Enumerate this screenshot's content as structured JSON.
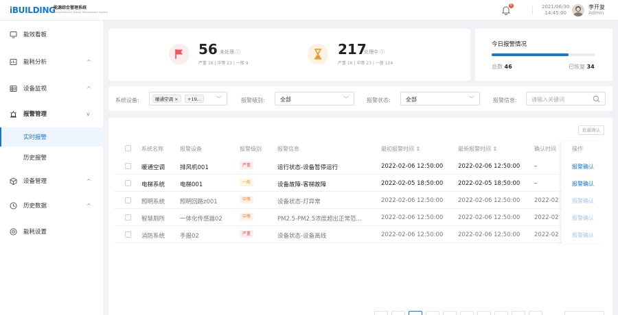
{
  "app": {
    "logo": "iBUILDING",
    "system_name": "能源综合管理系统",
    "system_name_en": "Comprehensive Energy Management System"
  },
  "header": {
    "notification_count": "6",
    "date": "2021/06/30",
    "time": "14:45:00",
    "user_name": "李开复",
    "user_role": "Admin"
  },
  "sidebar": {
    "items": [
      {
        "label": "能效看板",
        "icon": "monitor-icon"
      },
      {
        "label": "能耗分析",
        "icon": "chart-icon",
        "chevron": "^"
      },
      {
        "label": "设备监视",
        "icon": "grid-icon",
        "chevron": "^"
      },
      {
        "label": "报警管理",
        "icon": "alarm-icon",
        "chevron": "v"
      },
      {
        "label": "实时报警",
        "active": true
      },
      {
        "label": "历史报警"
      },
      {
        "label": "设备管理",
        "icon": "cube-icon",
        "chevron": "^"
      },
      {
        "label": "历史数据",
        "icon": "clock-icon",
        "chevron": "^"
      },
      {
        "label": "能耗设置",
        "icon": "settings-icon"
      }
    ]
  },
  "stats": {
    "unprocessed": {
      "count": "56",
      "label": "未处理",
      "severe": "严重 16",
      "medium": "中等 23",
      "general": "一般 9",
      "icon": "flag-icon",
      "color": "#f0535b"
    },
    "processing": {
      "count": "217",
      "label": "处理中",
      "severe": "严重 16",
      "medium": "中等 23",
      "general": "一般 124",
      "icon": "hourglass-icon",
      "color": "#f0a030"
    }
  },
  "today": {
    "title": "今日报警情况",
    "total_label": "总数",
    "total": "46",
    "recovered_label": "已恢复",
    "recovered": "34",
    "progress_fraction": 0.74
  },
  "filters": {
    "device_label": "系统设备:",
    "device_tag": "暖通空调",
    "device_more": "+19...",
    "level_label": "报警级别:",
    "level_value": "全部",
    "status_label": "报警状态:",
    "status_value": "全部",
    "info_label": "报警信息:",
    "info_placeholder": "请输入关键词"
  },
  "table": {
    "batch_confirm": "批量确认",
    "columns": [
      "系统名称",
      "报警设备",
      "报警级别",
      "报警信息",
      "最初报警时间 ⇕",
      "最新报警时间 ⇕",
      "确认时间",
      "操作"
    ],
    "rows": [
      {
        "system": "暖通空调",
        "device": "排风机001",
        "level": "严重",
        "info": "运行状态-设备暂停运行",
        "first": "2022-02-06 12:50:00",
        "latest": "2022-02-06 12:50:00",
        "confirm": "–",
        "action": "报警确认"
      },
      {
        "system": "电梯系统",
        "device": "电梯001",
        "level": "一般",
        "info": "设备故障-客梯故障",
        "first": "2022-02-05 18:50:00",
        "latest": "2022-02-05 18:50:00",
        "confirm": "–",
        "action": "报警确认"
      },
      {
        "system": "照明系统",
        "device": "照明回路z001",
        "level": "中等",
        "info": "设备状态-灯异常",
        "first": "2022-02-06 12:50:00",
        "latest": "2022-02-06 12:50:00",
        "confirm": "2022-02",
        "action": "报警确认"
      },
      {
        "system": "智慧厕所",
        "device": "一体化传感器02",
        "level": "中等",
        "info": "PM2.5-PM2.5浓度超出正常范...",
        "first": "2022-02-06 12:50:00",
        "latest": "2022-02-06 12:50:00",
        "confirm": "2022-02",
        "action": "报警确认"
      },
      {
        "system": "消防系统",
        "device": "手报02",
        "level": "严重",
        "info": "设备状态-设备离线",
        "first": "2022-02-06 12:50:00",
        "latest": "2022-02-06 12:50:00",
        "confirm": "2022-02",
        "action": "报警确认"
      }
    ]
  },
  "colors": {
    "accent": "#1677d2",
    "severe": "#e24c4c",
    "general": "#e0a21a",
    "medium": "#f07a28"
  }
}
